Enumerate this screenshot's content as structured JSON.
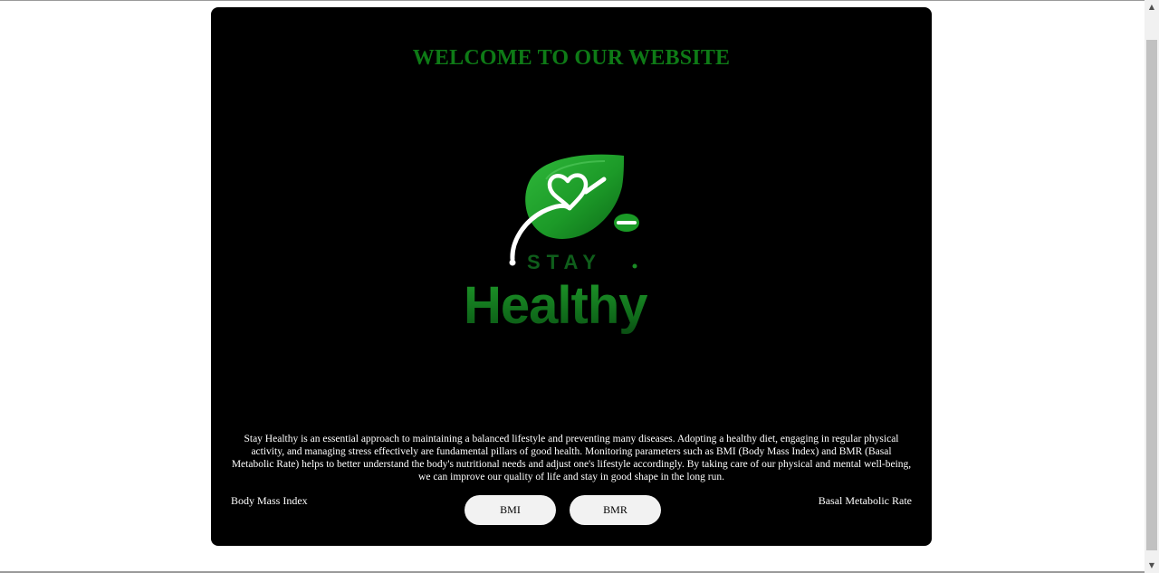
{
  "page": {
    "title": "WELCOME TO OUR WEBSITE",
    "description": "Stay Healthy is an essential approach to maintaining a balanced lifestyle and preventing many diseases. Adopting a healthy diet, engaging in regular physical activity, and managing stress effectively are fundamental pillars of good health. Monitoring parameters such as BMI (Body Mass Index) and BMR (Basal Metabolic Rate) helps to better understand the body's nutritional needs and adjust one's lifestyle accordingly. By taking care of our physical and mental well-being, we can improve our quality of life and stay in good shape in the long run."
  },
  "logo": {
    "line1": "STAY",
    "line2": "Healthy",
    "icon": "leaf-heart-icon"
  },
  "labels": {
    "left": "Body Mass Index",
    "right": "Basal Metabolic Rate"
  },
  "buttons": {
    "bmi": "BMI",
    "bmr": "BMR"
  },
  "scrollbar": {
    "up_icon": "▲",
    "down_icon": "▼"
  },
  "colors": {
    "background": "#ffffff",
    "card": "#000000",
    "title": "#0e7a16",
    "brand_green": "#1f9a2a",
    "button": "#f2f2f2"
  }
}
